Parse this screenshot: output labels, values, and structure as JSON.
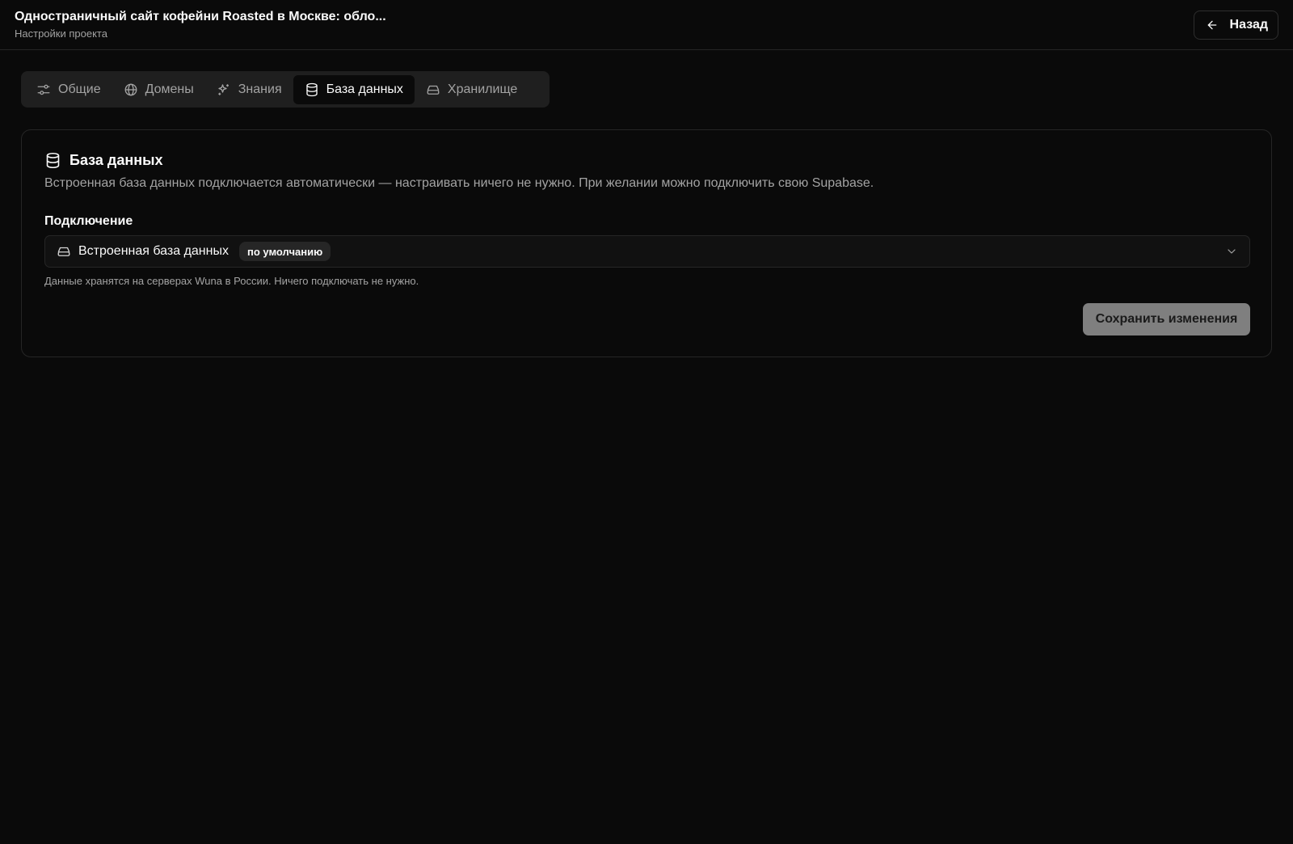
{
  "header": {
    "title": "Одностраничный сайт кофейни Roasted в Москве: обло...",
    "subtitle": "Настройки проекта",
    "back_label": "Назад"
  },
  "tabs": [
    {
      "label": "Общие",
      "icon": "sliders-icon",
      "active": false
    },
    {
      "label": "Домены",
      "icon": "globe-icon",
      "active": false
    },
    {
      "label": "Знания",
      "icon": "sparkles-icon",
      "active": false
    },
    {
      "label": "База данных",
      "icon": "database-icon",
      "active": true
    },
    {
      "label": "Хранилище",
      "icon": "hard-drive-icon",
      "active": false
    }
  ],
  "card": {
    "title": "База данных",
    "description": "Встроенная база данных подключается автоматически — настраивать ничего не нужно. При желании можно подключить свою Supabase.",
    "field_label": "Подключение",
    "select": {
      "value": "Встроенная база данных",
      "badge": "по умолчанию"
    },
    "hint": "Данные хранятся на серверах Wuna в России. Ничего подключать не нужно.",
    "save_label": "Сохранить изменения"
  },
  "colors": {
    "background": "#0a0a0a",
    "muted_text": "#a3a3a3",
    "border": "#262626",
    "disabled_button": "#7f7f7f"
  }
}
